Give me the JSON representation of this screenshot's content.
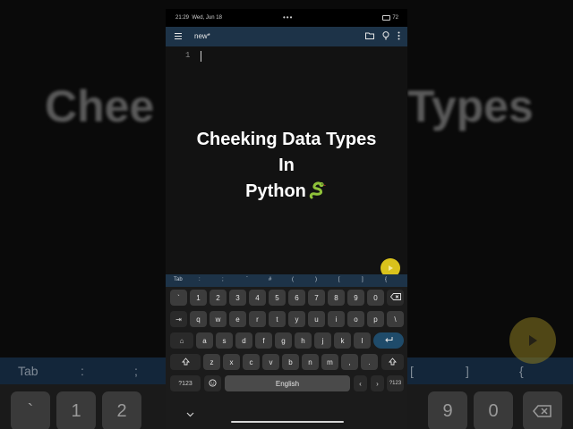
{
  "status_bar": {
    "time": "21:29",
    "date": "Wed, Jun 18",
    "indicators": "•••",
    "battery": "72"
  },
  "app_bar": {
    "menu_icon": "hamburger-menu-icon",
    "title": "new*",
    "icons": [
      "folder-icon",
      "lightbulb-icon",
      "more-vert-icon"
    ]
  },
  "editor": {
    "line_numbers": [
      "1"
    ],
    "content": ""
  },
  "overlay": {
    "line1": "Cheeking Data Types",
    "line2": "In",
    "line3": "Python",
    "emoji": "snake-icon"
  },
  "background": {
    "left_text": "Chee",
    "right_text": "Types",
    "toolbar_items": [
      "Tab",
      ":",
      ";",
      "[",
      "]",
      "{"
    ],
    "keys": [
      "`",
      "1",
      "2",
      "9",
      "0"
    ]
  },
  "symbol_bar": {
    "items": [
      "Tab",
      ":",
      ";",
      "`",
      "#",
      "(",
      ")",
      "[",
      "]",
      "{"
    ]
  },
  "keyboard": {
    "row1": [
      "`",
      "1",
      "2",
      "3",
      "4",
      "5",
      "6",
      "7",
      "8",
      "9",
      "0"
    ],
    "row2_tab": "⇥",
    "row2": [
      "q",
      "w",
      "e",
      "r",
      "t",
      "y",
      "u",
      "i",
      "o",
      "p",
      "\\"
    ],
    "row3_caps": "⌂",
    "row3": [
      "a",
      "s",
      "d",
      "f",
      "g",
      "h",
      "j",
      "k",
      "l"
    ],
    "row4": [
      "z",
      "x",
      "c",
      "v",
      "b",
      "n",
      "m",
      ",",
      "."
    ],
    "symbols_key": "?123",
    "space_label": "English",
    "left_arrow": "‹",
    "right_arrow": "›",
    "symbols_key_right": "?123"
  },
  "colors": {
    "app_bar": "#1d3348",
    "enter_key": "#1f4b6a",
    "play_button": "#d9c21c"
  }
}
